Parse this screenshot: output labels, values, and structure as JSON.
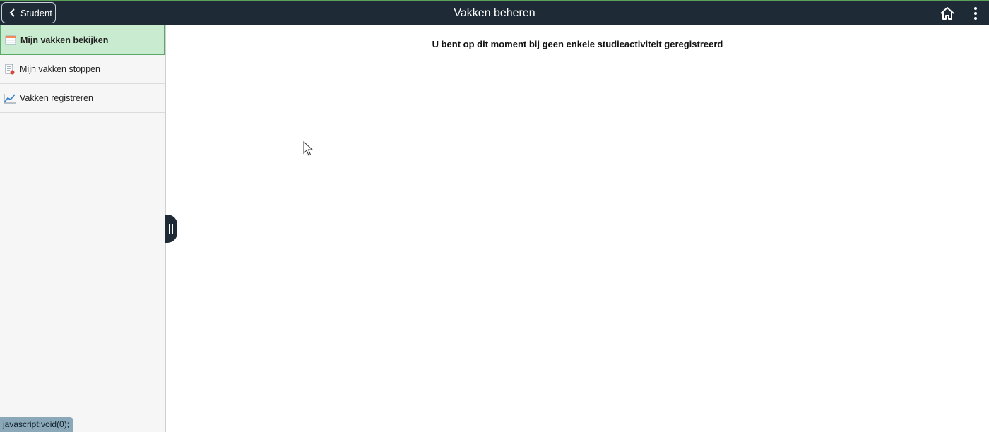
{
  "header": {
    "back_label": "Student",
    "title": "Vakken beheren",
    "home_icon": "home-icon",
    "menu_icon": "more-vertical-icon",
    "accent_color": "#5aa05a",
    "bg_color": "#1e2a36"
  },
  "sidebar": {
    "items": [
      {
        "label": "Mijn vakken bekijken",
        "icon": "calendar-icon",
        "active": true
      },
      {
        "label": "Mijn vakken stoppen",
        "icon": "drop-list-icon",
        "active": false
      },
      {
        "label": "Vakken registreren",
        "icon": "line-chart-icon",
        "active": false
      }
    ],
    "active_color": "#c9ebcf"
  },
  "main": {
    "message": "U bent op dit moment bij geen enkele studieactiviteit geregistreerd"
  },
  "status_bar": {
    "text": "javascript:void(0);"
  }
}
